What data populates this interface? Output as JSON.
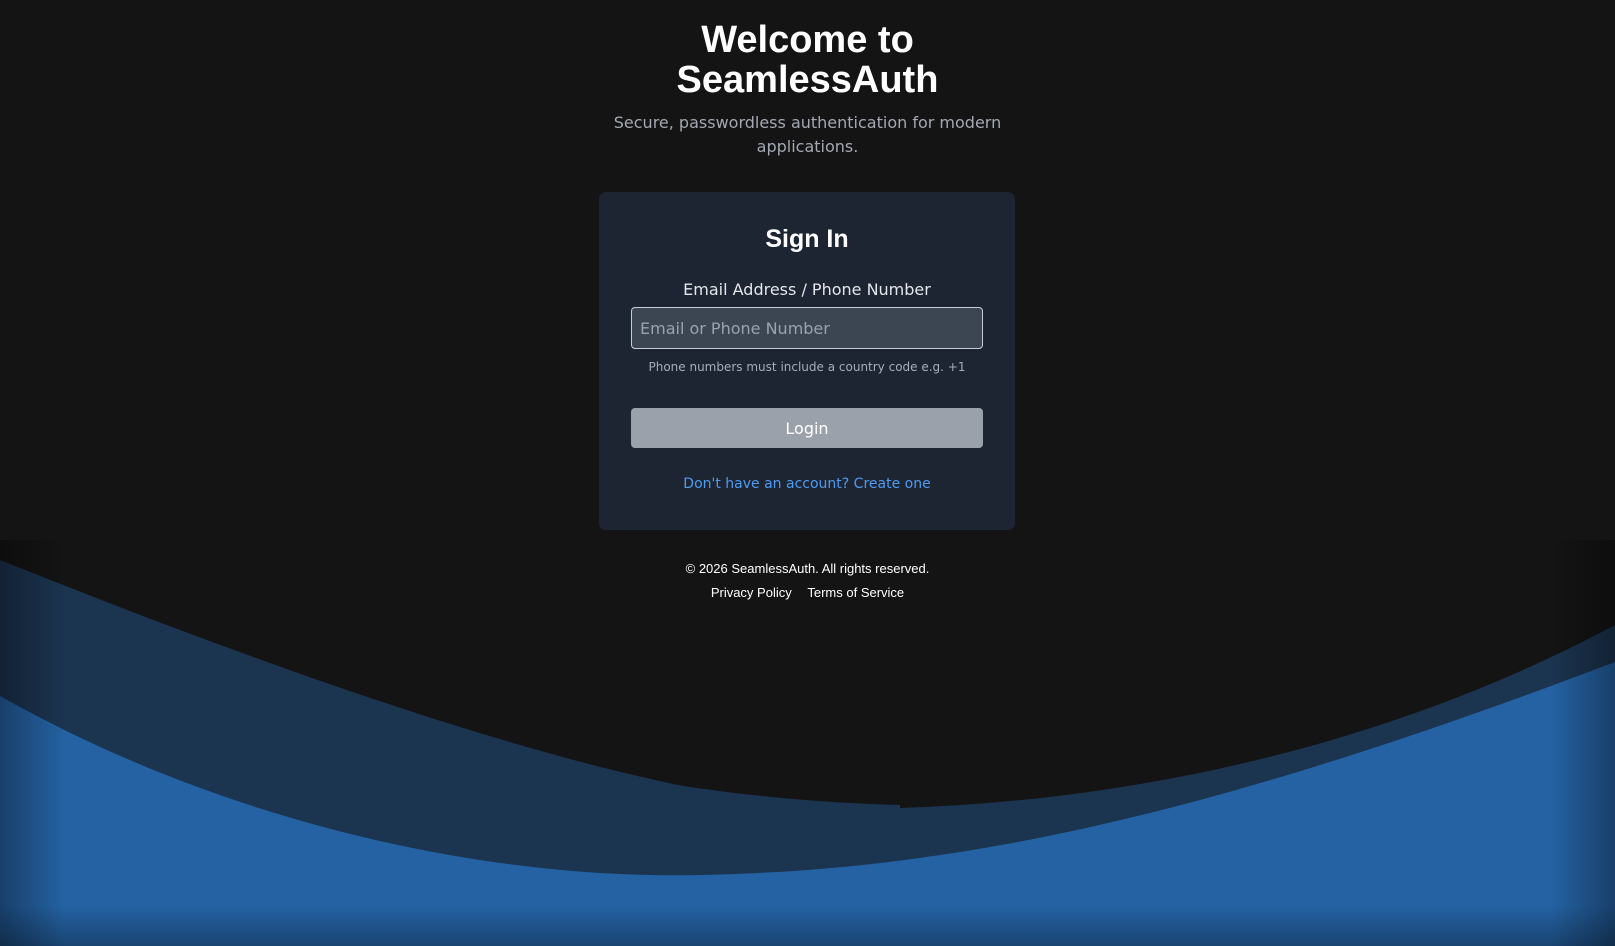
{
  "hero": {
    "title": "Welcome to SeamlessAuth",
    "subtitle": "Secure, passwordless authentication for modern applications."
  },
  "signin": {
    "title": "Sign In",
    "field_label": "Email Address / Phone Number",
    "input_placeholder": "Email or Phone Number",
    "input_value": "",
    "hint": "Phone numbers must include a country code e.g. +1",
    "login_label": "Login",
    "signup_link": "Don't have an account? Create one"
  },
  "footer": {
    "copyright": "© 2026 SeamlessAuth. All rights reserved.",
    "links": [
      "Privacy Policy",
      "Terms of Service"
    ]
  },
  "colors": {
    "background": "#141414",
    "card": "#1d2533",
    "accent_link": "#4f9bf0",
    "button": "#9ba1ab",
    "wave_dark": "#1b3450",
    "wave_blue": "#2462a3"
  }
}
